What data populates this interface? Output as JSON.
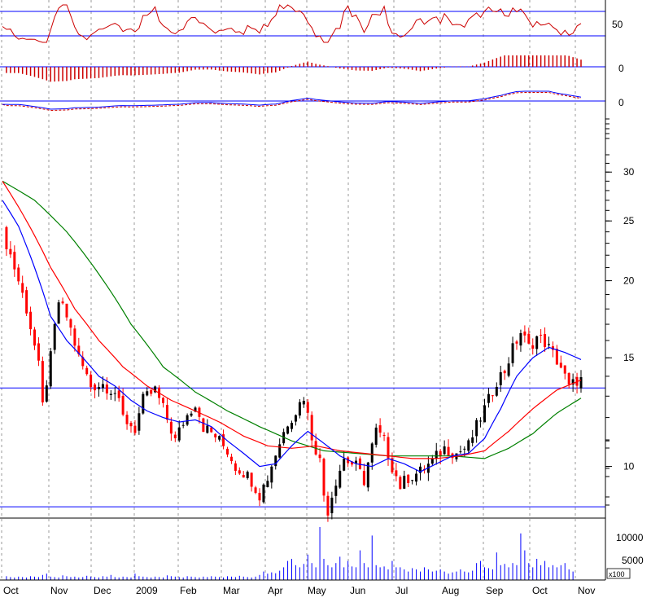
{
  "chart_data": {
    "type": "candlestick",
    "colors": {
      "background": "#ffffff",
      "down_candle": "#ff0000",
      "up_candle": "#000000",
      "ma_short": "#0000ff",
      "ma_mid": "#ff0000",
      "ma_long": "#008000",
      "reference_line": "#0000ff",
      "indicator_line": "#cc0000",
      "histogram": "#cc0000",
      "volume_bar": "#0000ff",
      "grid": "#999999"
    },
    "grid": true,
    "x_axis": {
      "months": [
        "Oct",
        "Nov",
        "Dec",
        "2009",
        "Feb",
        "Mar",
        "Apr",
        "May",
        "Jun",
        "Jul",
        "Aug",
        "Sep",
        "Oct",
        "Nov"
      ]
    },
    "price_panel": {
      "scale": "log",
      "ylim": [
        9.2,
        32.0
      ],
      "tick_labels": [
        "30",
        "25",
        "20",
        "15",
        "10"
      ],
      "tick_values": [
        30,
        25,
        20,
        15,
        10
      ],
      "reference_lines": [
        13.4,
        8.6
      ],
      "close_path": [
        [
          0,
          24.0
        ],
        [
          3,
          21.0
        ],
        [
          6,
          18.0
        ],
        [
          9,
          14.5
        ],
        [
          10,
          12.5
        ],
        [
          12,
          15.0
        ],
        [
          14,
          18.5
        ],
        [
          16,
          17.5
        ],
        [
          19,
          15.0
        ],
        [
          22,
          13.5
        ],
        [
          25,
          13.6
        ],
        [
          28,
          13.2
        ],
        [
          30,
          12.0
        ],
        [
          33,
          11.5
        ],
        [
          35,
          12.8
        ],
        [
          38,
          13.3
        ],
        [
          40,
          12.4
        ],
        [
          43,
          11.0
        ],
        [
          45,
          11.8
        ],
        [
          48,
          12.7
        ],
        [
          50,
          11.6
        ],
        [
          53,
          11.2
        ],
        [
          56,
          10.6
        ],
        [
          58,
          10.0
        ],
        [
          60,
          9.8
        ],
        [
          62,
          9.5
        ],
        [
          64,
          9.0
        ],
        [
          66,
          9.6
        ],
        [
          68,
          10.5
        ],
        [
          71,
          11.8
        ],
        [
          73,
          12.3
        ],
        [
          75,
          13.0
        ],
        [
          77,
          11.2
        ],
        [
          79,
          10.2
        ],
        [
          80,
          9.0
        ],
        [
          81,
          8.5
        ],
        [
          83,
          9.5
        ],
        [
          85,
          10.3
        ],
        [
          88,
          10.0
        ],
        [
          90,
          9.5
        ],
        [
          93,
          11.4
        ],
        [
          95,
          11.0
        ],
        [
          97,
          10.0
        ],
        [
          99,
          9.3
        ],
        [
          101,
          9.6
        ],
        [
          104,
          9.8
        ],
        [
          107,
          10.2
        ],
        [
          110,
          10.7
        ],
        [
          113,
          10.5
        ],
        [
          116,
          10.8
        ],
        [
          119,
          12.0
        ],
        [
          121,
          12.8
        ],
        [
          123,
          13.8
        ],
        [
          125,
          14.3
        ],
        [
          127,
          15.5
        ],
        [
          129,
          16.5
        ],
        [
          131,
          15.6
        ],
        [
          133,
          16.2
        ],
        [
          135,
          15.9
        ],
        [
          137,
          15.2
        ],
        [
          139,
          14.5
        ],
        [
          141,
          13.4
        ],
        [
          143,
          13.8
        ]
      ],
      "ma_short_path": [
        [
          0,
          27.0
        ],
        [
          4,
          24.5
        ],
        [
          8,
          21.0
        ],
        [
          12,
          17.5
        ],
        [
          16,
          16.0
        ],
        [
          20,
          15.0
        ],
        [
          24,
          14.0
        ],
        [
          28,
          13.5
        ],
        [
          32,
          12.8
        ],
        [
          36,
          12.3
        ],
        [
          40,
          12.0
        ],
        [
          44,
          11.8
        ],
        [
          48,
          11.9
        ],
        [
          52,
          11.6
        ],
        [
          56,
          11.0
        ],
        [
          60,
          10.5
        ],
        [
          64,
          10.0
        ],
        [
          68,
          10.1
        ],
        [
          72,
          10.8
        ],
        [
          76,
          11.4
        ],
        [
          80,
          10.9
        ],
        [
          84,
          10.4
        ],
        [
          88,
          10.1
        ],
        [
          92,
          10.0
        ],
        [
          96,
          10.3
        ],
        [
          100,
          10.1
        ],
        [
          104,
          9.8
        ],
        [
          108,
          10.1
        ],
        [
          112,
          10.4
        ],
        [
          116,
          10.5
        ],
        [
          120,
          11.1
        ],
        [
          124,
          12.4
        ],
        [
          128,
          14.0
        ],
        [
          132,
          15.0
        ],
        [
          136,
          15.6
        ],
        [
          140,
          15.3
        ],
        [
          144,
          14.9
        ]
      ],
      "ma_mid_path": [
        [
          0,
          29.0
        ],
        [
          6,
          25.0
        ],
        [
          12,
          21.0
        ],
        [
          18,
          18.0
        ],
        [
          24,
          16.0
        ],
        [
          30,
          14.5
        ],
        [
          36,
          13.5
        ],
        [
          42,
          12.8
        ],
        [
          48,
          12.3
        ],
        [
          54,
          11.8
        ],
        [
          60,
          11.2
        ],
        [
          66,
          10.8
        ],
        [
          72,
          10.7
        ],
        [
          78,
          10.8
        ],
        [
          84,
          10.6
        ],
        [
          90,
          10.5
        ],
        [
          96,
          10.4
        ],
        [
          102,
          10.3
        ],
        [
          108,
          10.3
        ],
        [
          114,
          10.4
        ],
        [
          120,
          10.6
        ],
        [
          126,
          11.4
        ],
        [
          132,
          12.4
        ],
        [
          138,
          13.3
        ],
        [
          144,
          13.8
        ]
      ],
      "ma_long_path": [
        [
          0,
          29.0
        ],
        [
          8,
          27.0
        ],
        [
          16,
          24.0
        ],
        [
          24,
          20.5
        ],
        [
          32,
          17.0
        ],
        [
          40,
          14.5
        ],
        [
          48,
          13.2
        ],
        [
          56,
          12.3
        ],
        [
          64,
          11.6
        ],
        [
          72,
          11.0
        ],
        [
          80,
          10.6
        ],
        [
          88,
          10.5
        ],
        [
          96,
          10.4
        ],
        [
          104,
          10.4
        ],
        [
          112,
          10.4
        ],
        [
          120,
          10.3
        ],
        [
          126,
          10.7
        ],
        [
          132,
          11.3
        ],
        [
          138,
          12.2
        ],
        [
          144,
          12.9
        ]
      ]
    },
    "volume_panel": {
      "tick_labels": [
        "10000",
        "5000"
      ],
      "tick_values": [
        10000,
        5000
      ],
      "multiplier_label": "x100",
      "values": [
        900,
        700,
        600,
        800,
        700,
        600,
        900,
        800,
        700,
        1200,
        1500,
        800,
        700,
        600,
        1100,
        900,
        700,
        800,
        600,
        700,
        1000,
        800,
        700,
        600,
        900,
        800,
        1200,
        700,
        600,
        800,
        700,
        600,
        1500,
        900,
        800,
        700,
        600,
        800,
        700,
        600,
        1100,
        900,
        800,
        700,
        600,
        900,
        800,
        700,
        600,
        800,
        700,
        900,
        800,
        700,
        600,
        900,
        800,
        700,
        1000,
        800,
        700,
        600,
        800,
        1200,
        2000,
        1500,
        1800,
        1600,
        2200,
        3000,
        4500,
        5000,
        3500,
        3000,
        3800,
        6000,
        4000,
        3000,
        12500,
        5000,
        3500,
        3000,
        4000,
        5500,
        3000,
        4500,
        3200,
        3000,
        7000,
        4000,
        3000,
        10500,
        3500,
        3000,
        3200,
        2500,
        4500,
        3000,
        3000,
        2500,
        2000,
        2800,
        2500,
        2000,
        3000,
        2500,
        2000,
        2200,
        2500,
        2000,
        1500,
        1800,
        2000,
        2500,
        2000,
        1800,
        2200,
        4000,
        4500,
        3000,
        2800,
        2500,
        6500,
        3500,
        3800,
        3000,
        4000,
        3500,
        11000,
        7000,
        4000,
        3000,
        5000,
        3500,
        4500,
        3000,
        3500,
        3000,
        3500,
        4000,
        2500,
        2000
      ]
    },
    "indicator_panels": [
      {
        "name": "oscillator",
        "tick_labels": [
          "50"
        ],
        "tick_values": [
          50
        ]
      },
      {
        "name": "histogram",
        "tick_labels": [
          "0"
        ],
        "tick_values": [
          0
        ]
      },
      {
        "name": "signal",
        "tick_labels": [
          "0"
        ],
        "tick_values": [
          0
        ]
      }
    ]
  }
}
